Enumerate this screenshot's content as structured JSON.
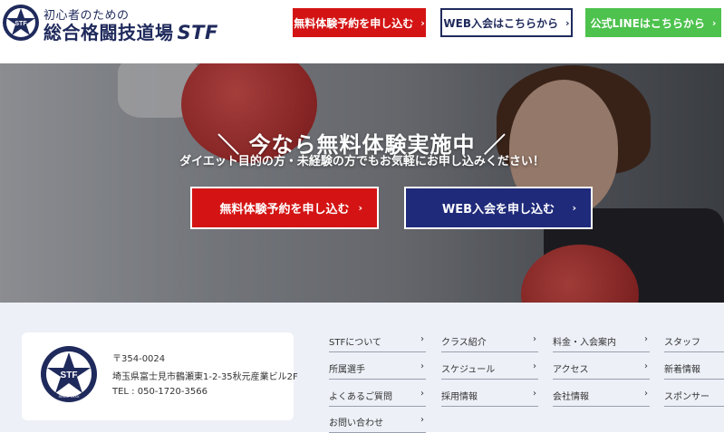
{
  "header": {
    "logo_small": "初心者のための",
    "logo_big": "総合格闘技道場",
    "logo_brand": "STF",
    "logo_badge": "STF",
    "btn_trial": "無料体験予約を申し込む",
    "btn_web": "WEB入会はこちらから",
    "btn_line": "公式LINEはこちらから"
  },
  "hero": {
    "title": "＼ 今なら無料体験実施中 ／",
    "subtitle": "ダイエット目的の方・未経験の方でもお気軽にお申し込みください！",
    "cta_trial": "無料体験予約を申し込む",
    "cta_web": "WEB入会を申し込む"
  },
  "footer": {
    "card_badge": "STF",
    "card_badge_sub": "SINCE 19XX",
    "postal": "〒354-0024",
    "address": "埼玉県富士見市鶴瀬東1-2-35秋元産業ビル2F",
    "tel": "TEL : 050-1720-3566",
    "nav": [
      {
        "label": "STFについて"
      },
      {
        "label": "クラス紹介"
      },
      {
        "label": "料金・入会案内"
      },
      {
        "label": "スタッフ"
      },
      {
        "label": "所属選手"
      },
      {
        "label": "スケジュール"
      },
      {
        "label": "アクセス"
      },
      {
        "label": "新着情報"
      },
      {
        "label": "よくあるご質問"
      },
      {
        "label": "採用情報"
      },
      {
        "label": "会社情報"
      },
      {
        "label": "スポンサー"
      },
      {
        "label": "お問い合わせ"
      }
    ]
  },
  "icons": {
    "chevron": "›"
  },
  "colors": {
    "brand_navy": "#1f2a5c",
    "red": "#d41414",
    "green": "#4dc24d",
    "cta_blue": "#1f2a7a",
    "footer_bg": "#edf0f7"
  }
}
